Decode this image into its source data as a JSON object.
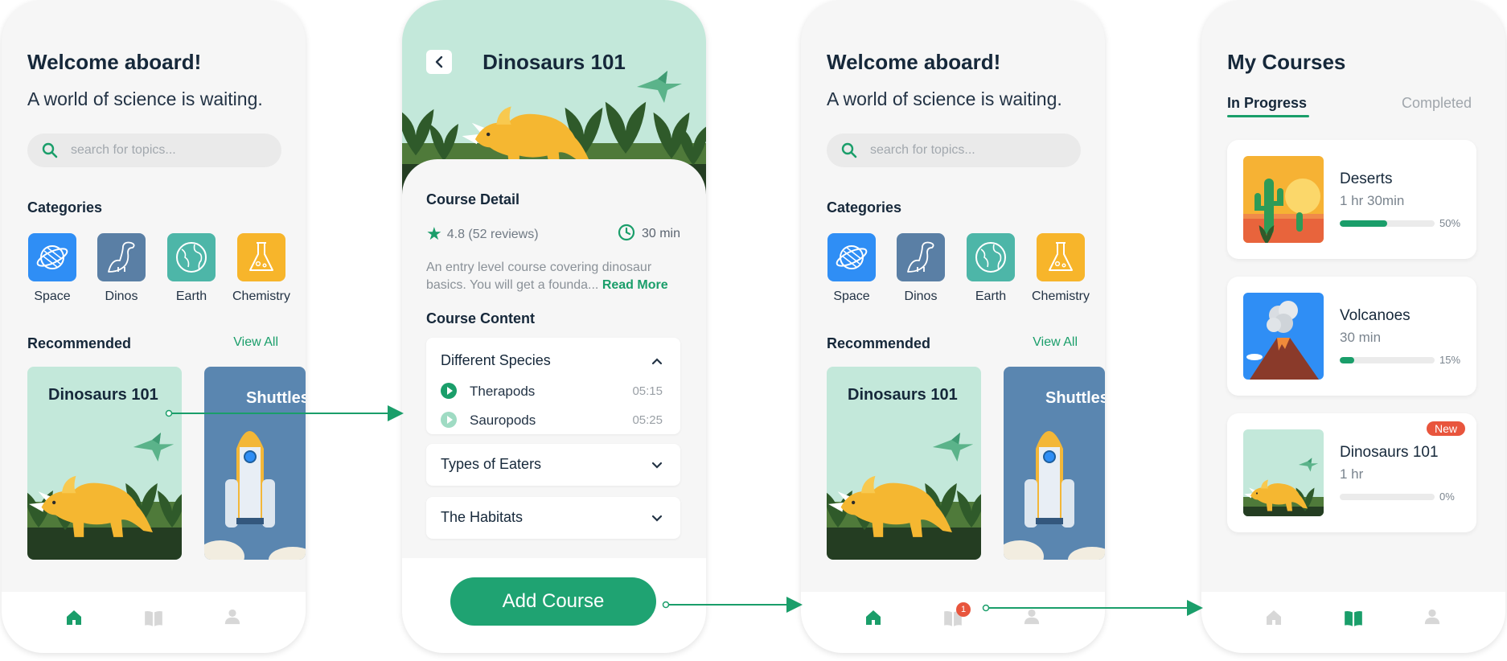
{
  "colors": {
    "accent": "#1a9e6a",
    "space": "#2f8ef5",
    "dinos": "#5a7fa5",
    "earth": "#4db6a8",
    "chemistry": "#f7b52b",
    "badge": "#e8553d"
  },
  "home": {
    "title": "Welcome aboard!",
    "subtitle": "A world of science is waiting.",
    "search_placeholder": "search for topics...",
    "categories_heading": "Categories",
    "categories": [
      {
        "label": "Space",
        "icon": "planet-icon"
      },
      {
        "label": "Dinos",
        "icon": "dinosaur-icon"
      },
      {
        "label": "Earth",
        "icon": "globe-icon"
      },
      {
        "label": "Chemistry",
        "icon": "flask-icon"
      }
    ],
    "recommended_heading": "Recommended",
    "view_all": "View All",
    "cards": [
      {
        "title": "Dinosaurs 101"
      },
      {
        "title": "Shuttles"
      }
    ],
    "cart_badge": "1"
  },
  "detail": {
    "title": "Dinosaurs 101",
    "course_detail_heading": "Course Detail",
    "rating": "4.8 (52 reviews)",
    "duration": "30 min",
    "description": "An entry level course covering dinosaur basics. You will get a founda...",
    "read_more": "Read More",
    "course_content_heading": "Course Content",
    "sections": [
      {
        "title": "Different Species",
        "expanded": true,
        "lessons": [
          {
            "title": "Therapods",
            "time": "05:15"
          },
          {
            "title": "Sauropods",
            "time": "05:25"
          }
        ]
      },
      {
        "title": "Types of Eaters",
        "expanded": false
      },
      {
        "title": "The Habitats",
        "expanded": false
      }
    ],
    "add_button": "Add Course"
  },
  "my_courses": {
    "title": "My Courses",
    "tab_in_progress": "In Progress",
    "tab_completed": "Completed",
    "courses": [
      {
        "name": "Deserts",
        "time": "1 hr 30min",
        "progress": 0.5,
        "pct": "50%"
      },
      {
        "name": "Volcanoes",
        "time": "30 min",
        "progress": 0.15,
        "pct": "15%"
      },
      {
        "name": "Dinosaurs 101",
        "time": "1 hr",
        "progress": 0.0,
        "pct": "0%",
        "badge": "New"
      }
    ]
  }
}
